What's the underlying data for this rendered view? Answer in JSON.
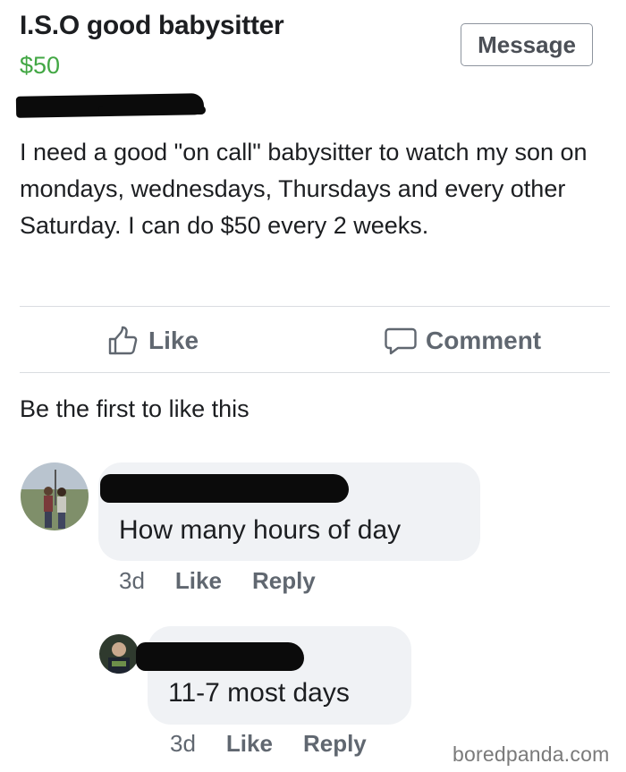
{
  "listing": {
    "title": "I.S.O good babysitter",
    "price": "$50",
    "message_label": "Message",
    "description": "I need a good \"on call\" babysitter to watch my son on mondays, wednesdays, Thursdays and every other Saturday. I can do $50 every 2 weeks."
  },
  "actions": {
    "like_label": "Like",
    "comment_label": "Comment",
    "like_icon": "thumbs-up-icon",
    "comment_icon": "speech-bubble-icon"
  },
  "likes_summary": "Be the first to like this",
  "comments": [
    {
      "text": "How many hours of day",
      "time": "3d",
      "like_label": "Like",
      "reply_label": "Reply"
    },
    {
      "text": "11-7 most days",
      "time": "3d",
      "like_label": "Like",
      "reply_label": "Reply"
    }
  ],
  "watermark": "boredpanda.com",
  "colors": {
    "price": "#42a744",
    "bubble": "#f0f2f5",
    "muted": "#606770"
  }
}
